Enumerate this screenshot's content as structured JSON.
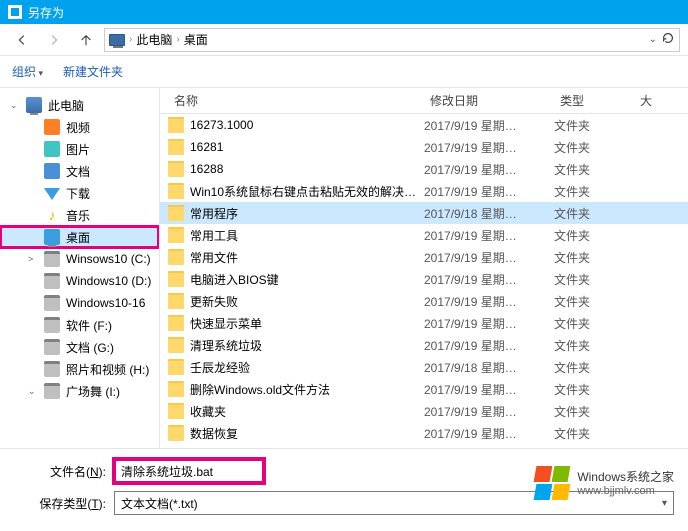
{
  "title": "另存为",
  "breadcrumb": {
    "root": "此电脑",
    "current": "桌面"
  },
  "toolbar": {
    "organize": "组织",
    "newfolder": "新建文件夹"
  },
  "sidebar": {
    "root": "此电脑",
    "items": [
      {
        "label": "视频",
        "icon": "video"
      },
      {
        "label": "图片",
        "icon": "pic"
      },
      {
        "label": "文档",
        "icon": "doc"
      },
      {
        "label": "下载",
        "icon": "dl"
      },
      {
        "label": "音乐",
        "icon": "music"
      },
      {
        "label": "桌面",
        "icon": "desktop",
        "selected": true
      },
      {
        "label": "Winsows10 (C:)",
        "icon": "drive",
        "expander": ">"
      },
      {
        "label": "Windows10 (D:)",
        "icon": "drive"
      },
      {
        "label": "Windows10-16",
        "icon": "drive"
      },
      {
        "label": "软件 (F:)",
        "icon": "drive"
      },
      {
        "label": "文档 (G:)",
        "icon": "drive"
      },
      {
        "label": "照片和视频 (H:)",
        "icon": "drive"
      },
      {
        "label": "广场舞 (I:)",
        "icon": "drive",
        "expander": "⌄"
      }
    ]
  },
  "columns": {
    "name": "名称",
    "date": "修改日期",
    "type": "类型",
    "size": "大"
  },
  "files": [
    {
      "name": "16273.1000",
      "date": "2017/9/19 星期…",
      "type": "文件夹"
    },
    {
      "name": "16281",
      "date": "2017/9/19 星期…",
      "type": "文件夹"
    },
    {
      "name": "16288",
      "date": "2017/9/19 星期…",
      "type": "文件夹"
    },
    {
      "name": "Win10系统鼠标右键点击粘贴无效的解决…",
      "date": "2017/9/19 星期…",
      "type": "文件夹"
    },
    {
      "name": "常用程序",
      "date": "2017/9/18 星期…",
      "type": "文件夹",
      "selected": true
    },
    {
      "name": "常用工具",
      "date": "2017/9/19 星期…",
      "type": "文件夹"
    },
    {
      "name": "常用文件",
      "date": "2017/9/19 星期…",
      "type": "文件夹"
    },
    {
      "name": "电脑进入BIOS键",
      "date": "2017/9/19 星期…",
      "type": "文件夹"
    },
    {
      "name": "更新失败",
      "date": "2017/9/19 星期…",
      "type": "文件夹"
    },
    {
      "name": "快速显示菜单",
      "date": "2017/9/19 星期…",
      "type": "文件夹"
    },
    {
      "name": "清理系统垃圾",
      "date": "2017/9/19 星期…",
      "type": "文件夹"
    },
    {
      "name": "壬辰龙经验",
      "date": "2017/9/18 星期…",
      "type": "文件夹"
    },
    {
      "name": "删除Windows.old文件方法",
      "date": "2017/9/19 星期…",
      "type": "文件夹"
    },
    {
      "name": "收藏夹",
      "date": "2017/9/19 星期…",
      "type": "文件夹"
    },
    {
      "name": "数据恢复",
      "date": "2017/9/19 星期…",
      "type": "文件夹"
    }
  ],
  "filename": {
    "label_pre": "文件名(",
    "label_u": "N",
    "label_post": "):",
    "value": "清除系统垃圾.bat"
  },
  "filetype": {
    "label_pre": "保存类型(",
    "label_u": "T",
    "label_post": "):",
    "value": "文本文档(*.txt)"
  },
  "watermark": {
    "line1": "Windows系统之家",
    "line2": "www.bjjmlv.com"
  }
}
